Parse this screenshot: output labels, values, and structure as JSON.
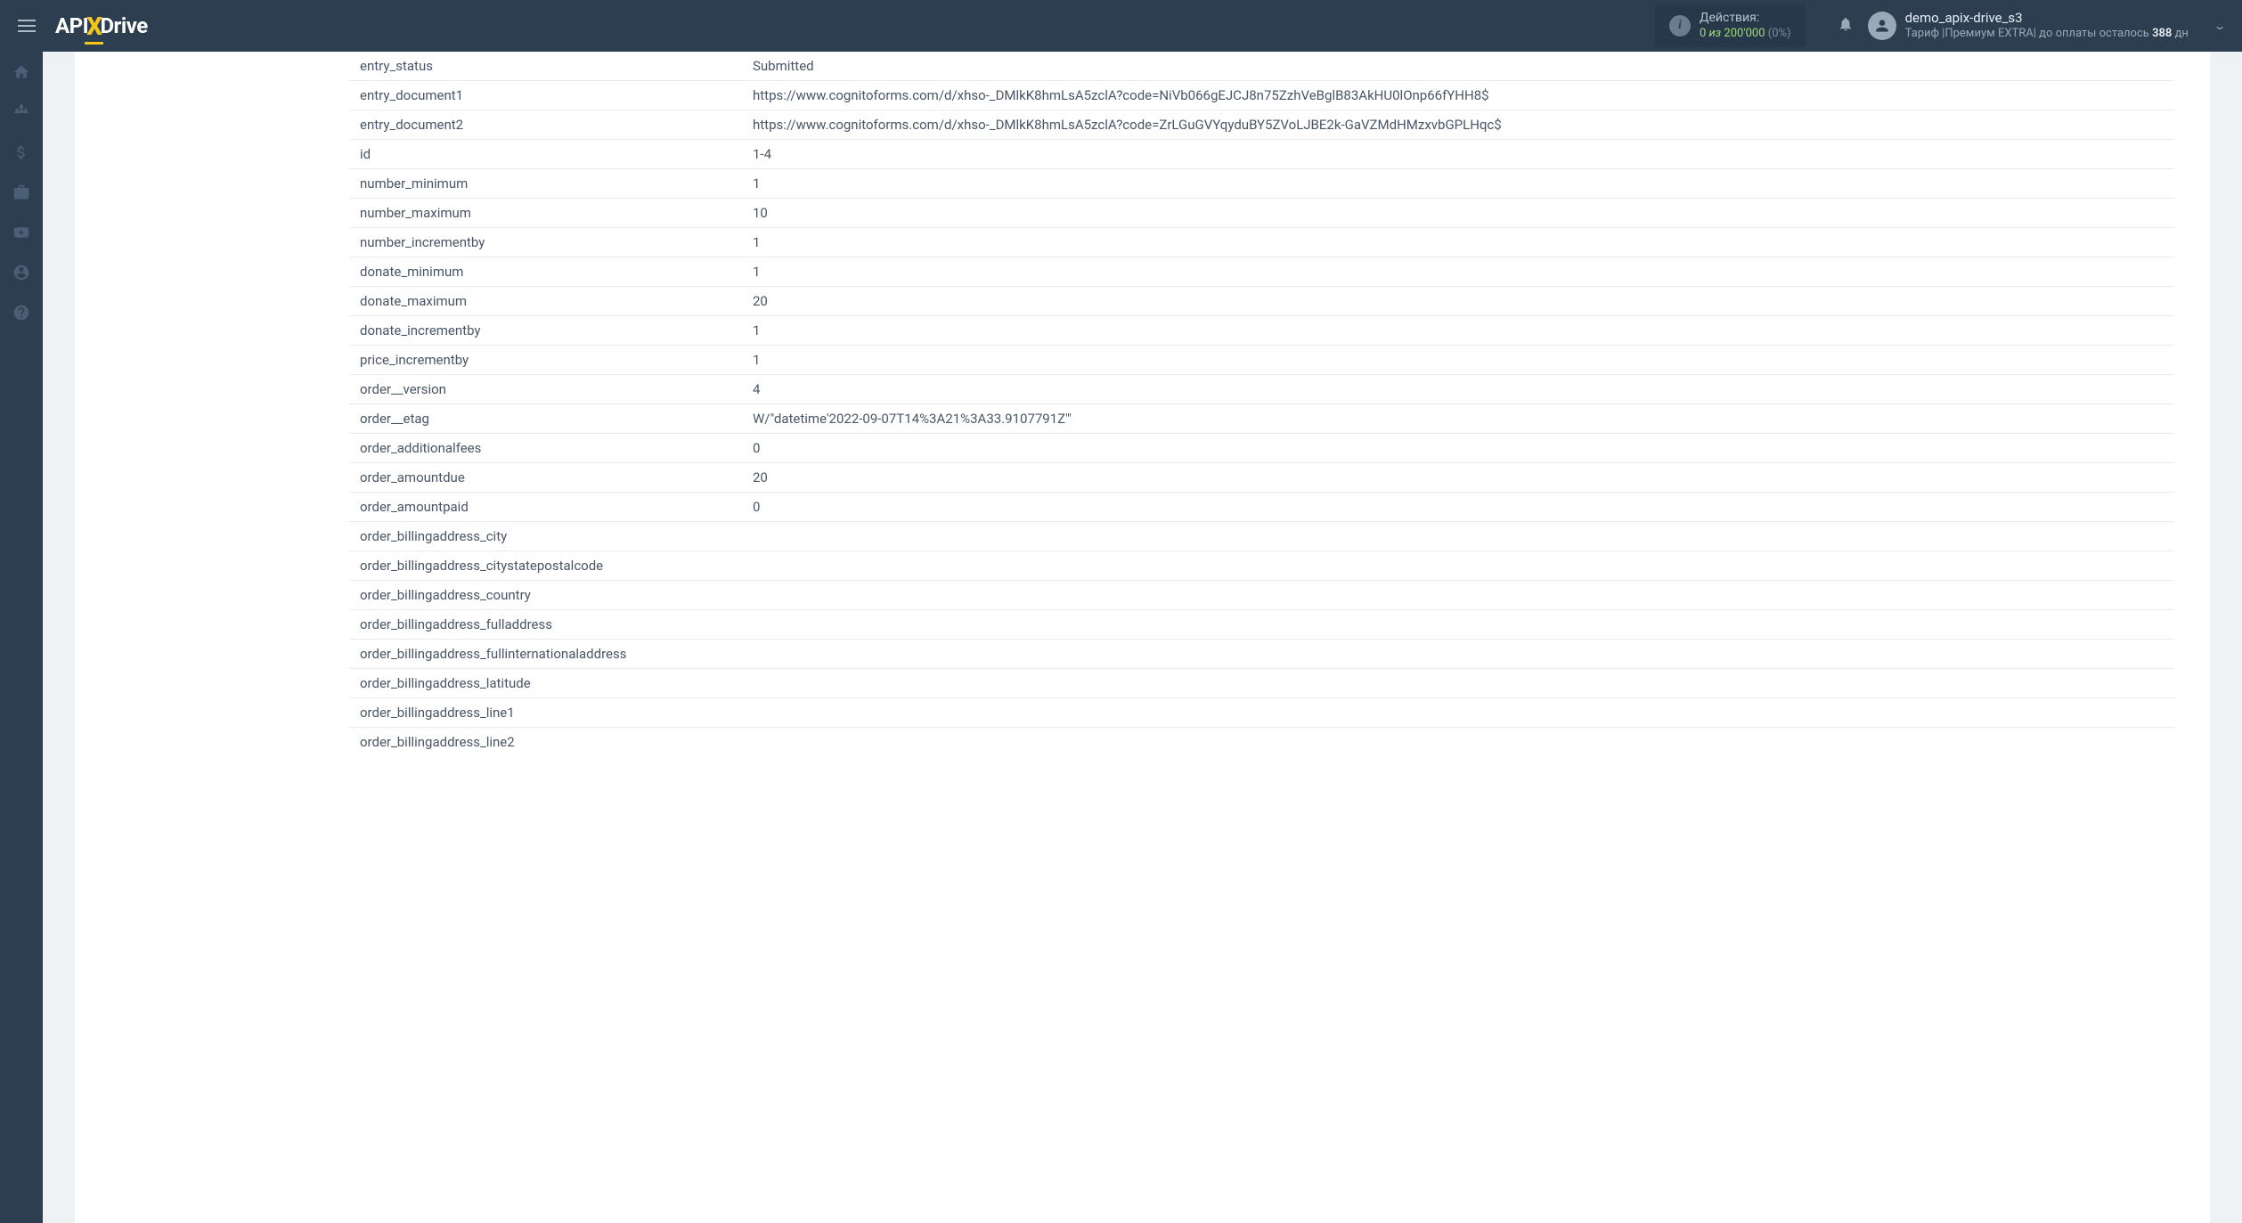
{
  "topbar": {
    "logo_api": "API",
    "logo_x": "X",
    "logo_drive": "Drive",
    "actions_label": "Действия:",
    "actions_num": "0",
    "actions_of": "из",
    "actions_total": "200'000",
    "actions_pct": "(0%)",
    "user_name": "demo_apix-drive_s3",
    "tariff_prefix": "Тариф |",
    "tariff_plan": "Премиум EXTRA",
    "tariff_mid": "| до оплаты осталось ",
    "tariff_days": "388",
    "tariff_suffix": " дн"
  },
  "rows": [
    {
      "key": "entry_status",
      "value": "Submitted"
    },
    {
      "key": "entry_document1",
      "value": "https://www.cognitoforms.com/d/xhso-_DMlkK8hmLsA5zclA?code=NiVb066gEJCJ8n75ZzhVeBglB83AkHU0lOnp66fYHH8$"
    },
    {
      "key": "entry_document2",
      "value": "https://www.cognitoforms.com/d/xhso-_DMlkK8hmLsA5zclA?code=ZrLGuGVYqyduBY5ZVoLJBE2k-GaVZMdHMzxvbGPLHqc$"
    },
    {
      "key": "id",
      "value": "1-4"
    },
    {
      "key": "number_minimum",
      "value": "1"
    },
    {
      "key": "number_maximum",
      "value": "10"
    },
    {
      "key": "number_incrementby",
      "value": "1"
    },
    {
      "key": "donate_minimum",
      "value": "1"
    },
    {
      "key": "donate_maximum",
      "value": "20"
    },
    {
      "key": "donate_incrementby",
      "value": "1"
    },
    {
      "key": "price_incrementby",
      "value": "1"
    },
    {
      "key": "order__version",
      "value": "4"
    },
    {
      "key": "order__etag",
      "value": "W/\"datetime'2022-09-07T14%3A21%3A33.9107791Z'\""
    },
    {
      "key": "order_additionalfees",
      "value": "0"
    },
    {
      "key": "order_amountdue",
      "value": "20"
    },
    {
      "key": "order_amountpaid",
      "value": "0"
    },
    {
      "key": "order_billingaddress_city",
      "value": ""
    },
    {
      "key": "order_billingaddress_citystatepostalcode",
      "value": ""
    },
    {
      "key": "order_billingaddress_country",
      "value": ""
    },
    {
      "key": "order_billingaddress_fulladdress",
      "value": ""
    },
    {
      "key": "order_billingaddress_fullinternationaladdress",
      "value": ""
    },
    {
      "key": "order_billingaddress_latitude",
      "value": ""
    },
    {
      "key": "order_billingaddress_line1",
      "value": ""
    },
    {
      "key": "order_billingaddress_line2",
      "value": ""
    }
  ]
}
